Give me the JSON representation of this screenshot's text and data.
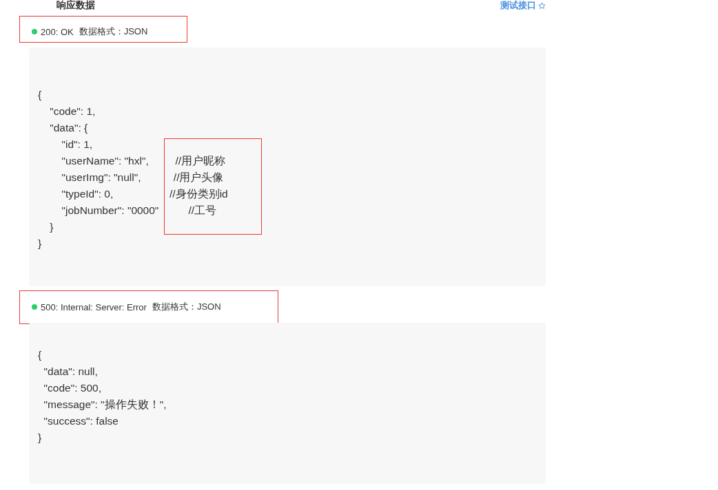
{
  "header": {
    "title": "响应数据",
    "link": "测试接口"
  },
  "responses": [
    {
      "status": "200: OK",
      "format_label": "数据格式：JSON",
      "highlighted": true,
      "comment_highlighted": true,
      "lines": [
        "{",
        "    \"code\": 1,",
        "    \"data\": {",
        "        \"id\": 1,",
        "        \"userName\": \"hxl\",         //用户昵称",
        "        \"userImg\": \"null\",           //用户头像",
        "        \"typeId\": 0,                   //身份类别id",
        "        \"jobNumber\": \"0000\"          //工号",
        "    }",
        "}"
      ]
    },
    {
      "status": "500: Internal: Server: Error",
      "format_label": "数据格式：JSON",
      "highlighted": true,
      "comment_highlighted": false,
      "lines": [
        "{",
        "  \"data\": null,",
        "  \"code\": 500,",
        "  \"message\": \"操作失败！\",",
        "  \"success\": false",
        "}"
      ]
    }
  ]
}
